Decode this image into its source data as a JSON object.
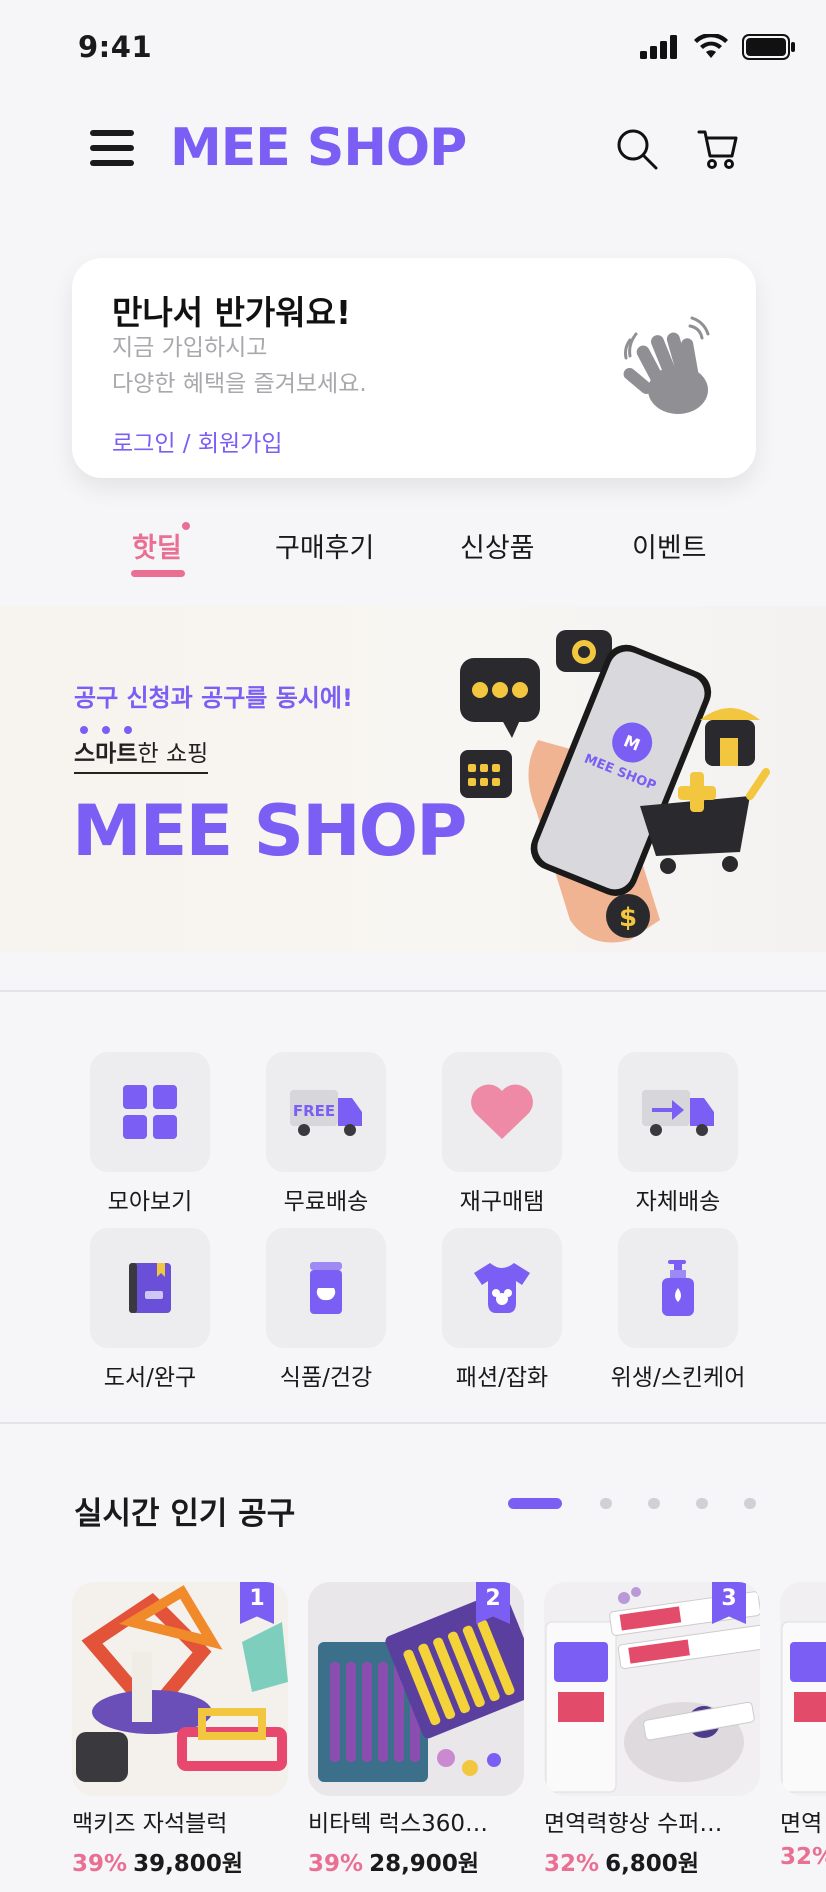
{
  "status_bar": {
    "time": "9:41"
  },
  "header": {
    "logo": "MEE SHOP"
  },
  "welcome": {
    "title": "만나서 반가워요!",
    "subtitle_line1": "지금 가입하시고",
    "subtitle_line2": "다양한 혜택을 즐겨보세요.",
    "link": "로그인 / 회원가입"
  },
  "tabs": [
    {
      "label": "핫딜",
      "active": true
    },
    {
      "label": "구매후기",
      "active": false
    },
    {
      "label": "신상품",
      "active": false
    },
    {
      "label": "이벤트",
      "active": false
    }
  ],
  "banner": {
    "tag": "공구 신청과 공구를 동시에!",
    "sub_bold": "스마트",
    "sub_rest": "한 쇼핑",
    "logo": "MEE SHOP",
    "phone_label": "MEE SHOP"
  },
  "categories": [
    {
      "label": "모아보기",
      "icon": "grid-icon"
    },
    {
      "label": "무료배송",
      "icon": "free-truck-icon",
      "badge": "FREE"
    },
    {
      "label": "재구매탬",
      "icon": "heart-icon"
    },
    {
      "label": "자체배송",
      "icon": "delivery-truck-icon"
    },
    {
      "label": "도서/완구",
      "icon": "book-icon"
    },
    {
      "label": "식품/건강",
      "icon": "food-cup-icon"
    },
    {
      "label": "패션/잡화",
      "icon": "baby-onesie-icon"
    },
    {
      "label": "위생/스킨케어",
      "icon": "pump-bottle-icon"
    }
  ],
  "popular": {
    "title": "실시간 인기 공구",
    "page_count": 5,
    "active_page": 1,
    "products": [
      {
        "rank": "1",
        "name": "맥키즈 자석블럭",
        "discount": "39%",
        "price": "39,800원"
      },
      {
        "rank": "2",
        "name": "비타텍 럭스360…",
        "discount": "39%",
        "price": "28,900원"
      },
      {
        "rank": "3",
        "name": "면역력향상 수퍼…",
        "discount": "32%",
        "price": "6,800원"
      },
      {
        "rank": "",
        "name": "면역",
        "discount": "32%",
        "price": ""
      }
    ]
  },
  "colors": {
    "accent": "#7b5ef3",
    "pink": "#e96f93",
    "background": "#f6f6f8"
  }
}
